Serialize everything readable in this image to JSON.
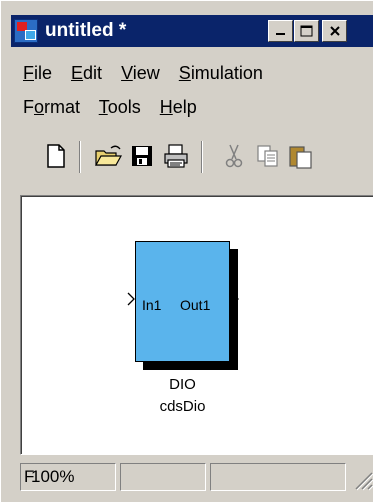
{
  "window": {
    "title": "untitled *",
    "buttons": {
      "minimize": "minimize",
      "maximize": "maximize",
      "close": "close"
    }
  },
  "menu": {
    "row1": [
      {
        "label": "File",
        "accel": "F",
        "rest": "ile"
      },
      {
        "label": "Edit",
        "accel": "E",
        "rest": "dit"
      },
      {
        "label": "View",
        "accel": "V",
        "rest": "iew"
      },
      {
        "label": "Simulation",
        "accel": "S",
        "rest": "imulation"
      }
    ],
    "row2": [
      {
        "label": "Format",
        "pre": "F",
        "accel": "o",
        "rest": "rmat"
      },
      {
        "label": "Tools",
        "accel": "T",
        "rest": "ools"
      },
      {
        "label": "Help",
        "accel": "H",
        "rest": "elp"
      }
    ]
  },
  "toolbar": {
    "icons": [
      "new-document-icon",
      "open-folder-icon",
      "save-icon",
      "print-icon",
      "cut-icon",
      "copy-icon",
      "paste-icon"
    ]
  },
  "diagram": {
    "block": {
      "name": "DIO",
      "sublabel": "cdsDio",
      "input_label": "In1",
      "output_label": "Out1",
      "color": "#5ab4ec"
    }
  },
  "status": {
    "left": "F",
    "zoom": "100%"
  },
  "colors": {
    "titlebar": "#0a246a",
    "chrome": "#d4d0c8",
    "canvas": "#ffffff"
  }
}
